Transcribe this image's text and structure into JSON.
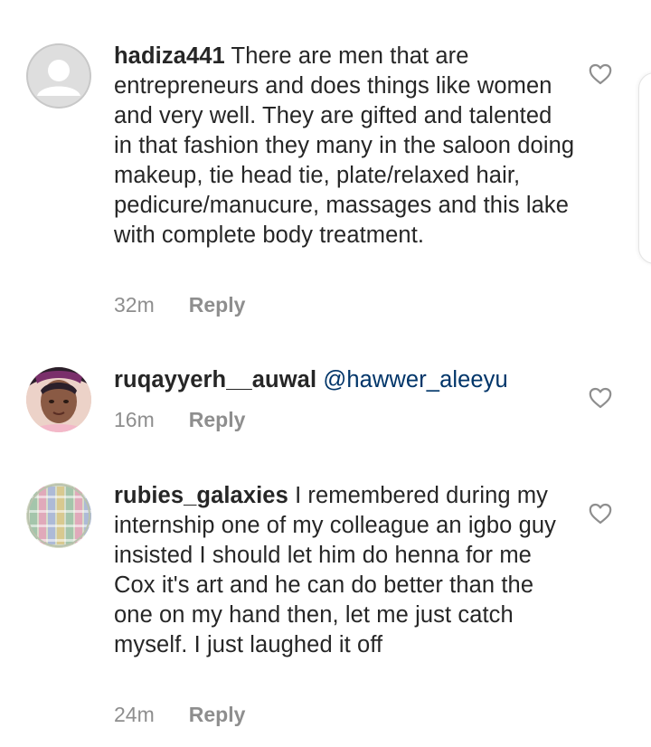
{
  "comments": [
    {
      "username": "hadiza441",
      "text": "There are men that are entrepreneurs and does things like women and very well. They are gifted and talented in that fashion they many in the saloon doing makeup, tie head tie, plate/relaxed hair, pedicure/manucure, massages and this lake with complete body treatment.",
      "time": "32m",
      "reply_label": "Reply",
      "avatar": "default-avatar"
    },
    {
      "username": "ruqayyerh__auwal",
      "mention": "@hawwer_aleeyu",
      "time": "16m",
      "reply_label": "Reply",
      "avatar": "photo-avatar"
    },
    {
      "username": "rubies_galaxies",
      "text": "I remembered during my internship one of my colleague an igbo  guy insisted I should let him do henna for me Cox it's art and he can do better than the one on my hand then, let me just catch myself. I just laughed it off",
      "time": "24m",
      "reply_label": "Reply",
      "avatar": "pattern-avatar"
    }
  ],
  "icons": {
    "like": "heart-outline-icon"
  },
  "colors": {
    "text": "#262626",
    "meta": "#8e8e8e",
    "mention": "#003569",
    "heart": "#8e8e8e"
  }
}
